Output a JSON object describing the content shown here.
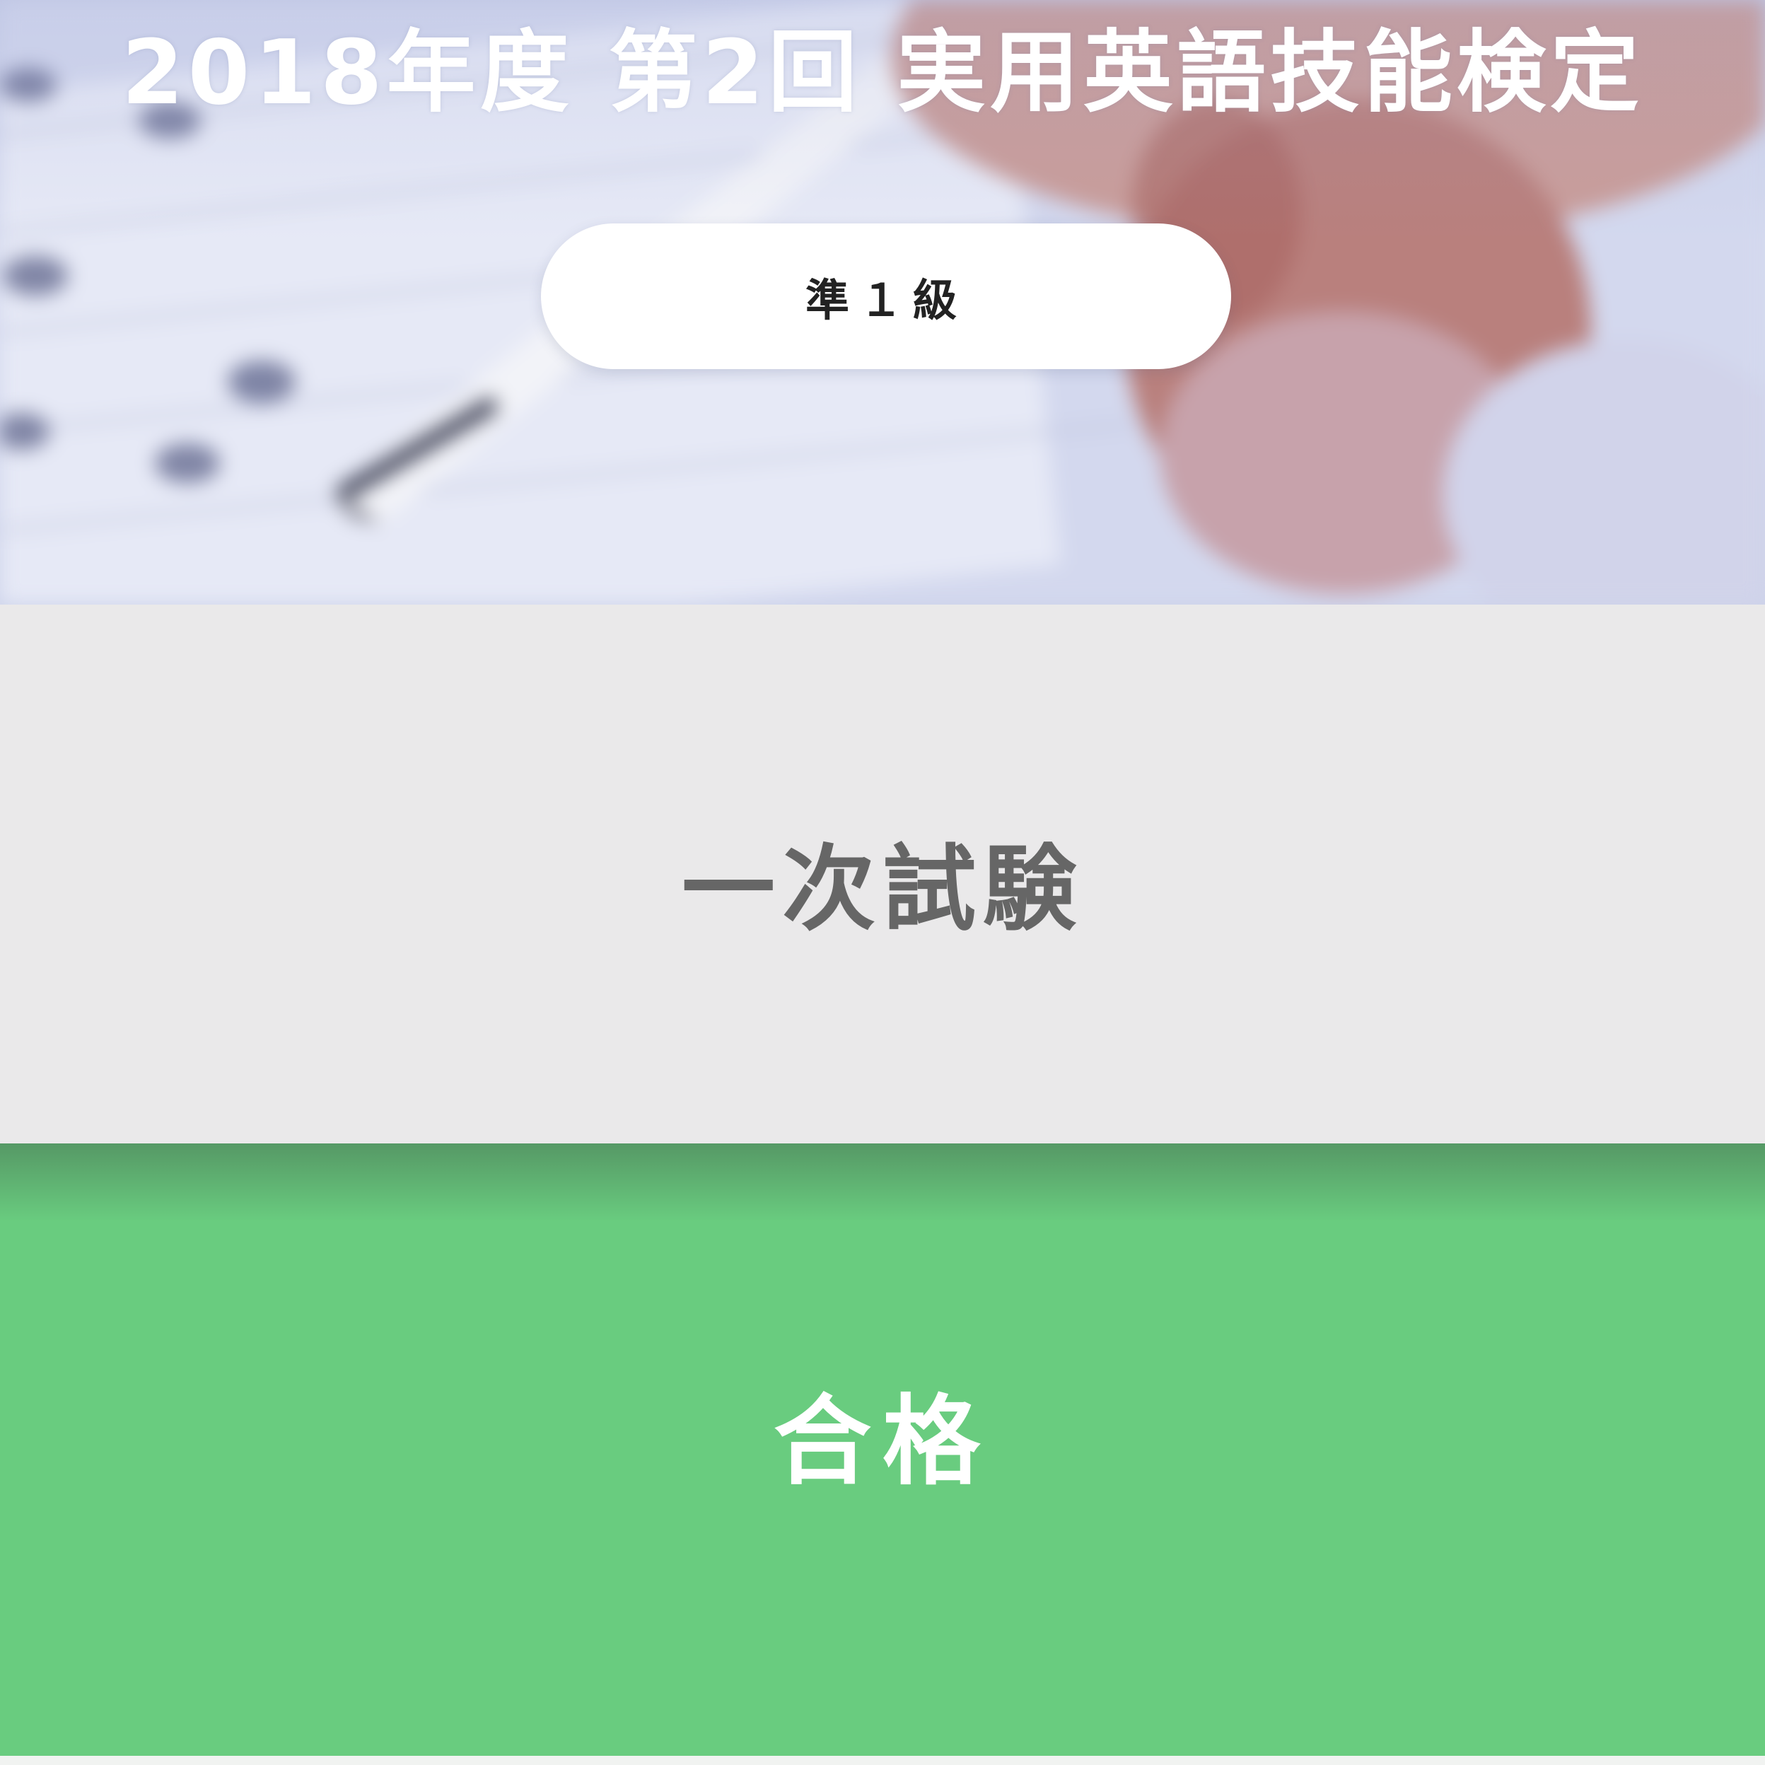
{
  "hero": {
    "title": "2018年度 第2回 実用英語技能検定",
    "grade": "準１級"
  },
  "exam": {
    "stage": "一次試験"
  },
  "result": {
    "status": "合格"
  },
  "colors": {
    "result_bg": "#69cc7f",
    "exam_bg": "#eae9ea",
    "exam_text": "#666666",
    "pill_bg": "#ffffff"
  }
}
